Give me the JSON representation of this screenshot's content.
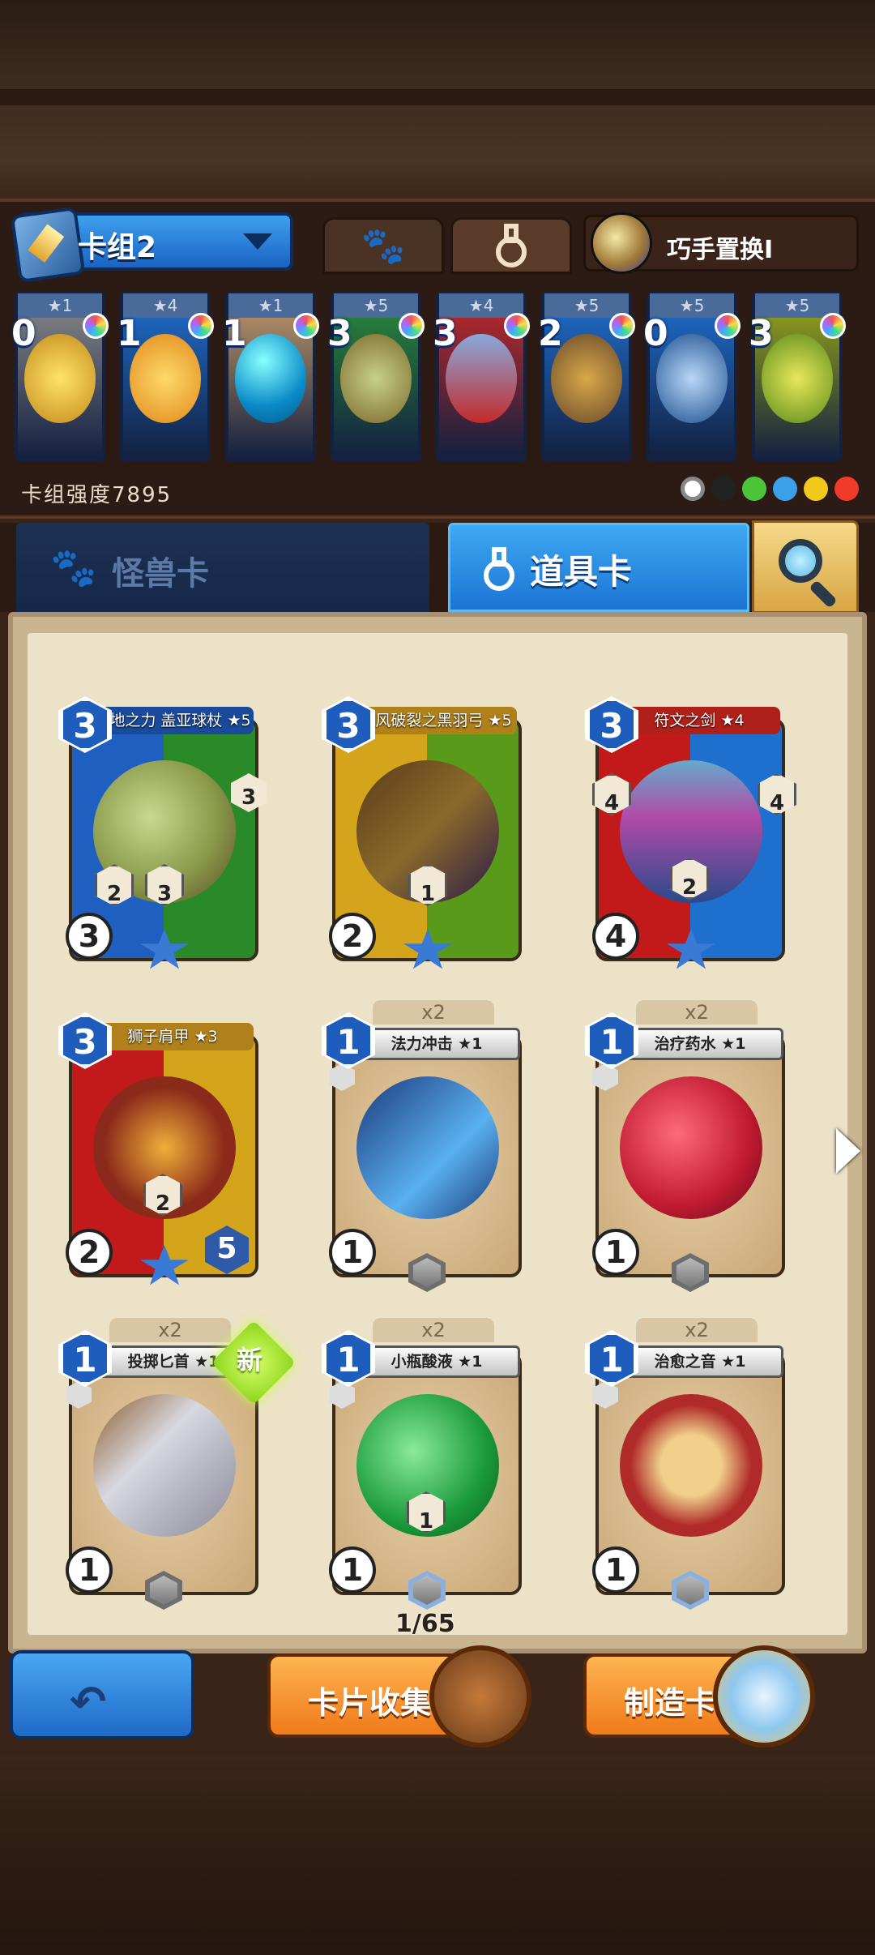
{
  "header": {
    "deck_name": "卡组2",
    "skill_name": "巧手置换I",
    "deck_strength": "卡组强度7895"
  },
  "deck_cards": [
    {
      "stars": "★1",
      "cost": "0",
      "color": "#8a8a8a"
    },
    {
      "stars": "★4",
      "cost": "1",
      "color": "#1f6fcf"
    },
    {
      "stars": "★1",
      "cost": "1",
      "color": "#c29a6a"
    },
    {
      "stars": "★5",
      "cost": "3",
      "color": "#2a8a3a"
    },
    {
      "stars": "★4",
      "cost": "3",
      "color": "#c22a2a"
    },
    {
      "stars": "★5",
      "cost": "2",
      "color": "#1f6fcf"
    },
    {
      "stars": "★5",
      "cost": "0",
      "color": "#1f6fcf"
    },
    {
      "stars": "★5",
      "cost": "3",
      "color": "#9aa81a"
    }
  ],
  "tabs": {
    "monster": "怪兽卡",
    "item": "道具卡"
  },
  "cards": [
    {
      "title": "大地之力 盖亚球杖 ★5",
      "cost": "3",
      "bottom": "3",
      "tl1": "",
      "left1": "2",
      "left2": "3",
      "right": "3"
    },
    {
      "title": "疾风破裂之黑羽弓 ★5",
      "cost": "3",
      "bottom": "2",
      "left1": "",
      "left2": "1"
    },
    {
      "title": "符文之剑 ★4",
      "cost": "3",
      "bottom": "4",
      "side_l": "4",
      "side_r": "4",
      "mid": "2"
    },
    {
      "title": "狮子肩甲 ★3",
      "cost": "3",
      "bottom": "2",
      "mid": "2",
      "right": "5"
    },
    {
      "title": "法力冲击 ★1",
      "cost": "1",
      "bottom": "1",
      "count": "x2"
    },
    {
      "title": "治疗药水 ★1",
      "cost": "1",
      "bottom": "1",
      "count": "x2"
    },
    {
      "title": "投掷匕首 ★1",
      "cost": "1",
      "bottom": "1",
      "count": "x2",
      "badge": "新"
    },
    {
      "title": "小瓶酸液 ★1",
      "cost": "1",
      "bottom": "1",
      "count": "x2",
      "mid": "1"
    },
    {
      "title": "治愈之音 ★1",
      "cost": "1",
      "bottom": "1",
      "count": "x2"
    }
  ],
  "pager": "1/65",
  "buttons": {
    "collect": "卡片收集",
    "craft": "制造卡片"
  },
  "colors": {
    "blue_accent": "#1f6fcf",
    "orange_button": "#ef7a1a",
    "parchment": "#ece2c8"
  }
}
